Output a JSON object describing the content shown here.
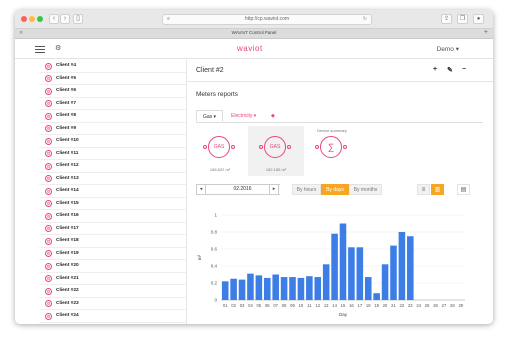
{
  "browser": {
    "url": "http://cp.waviot.com",
    "tab_title": "WAVIoT Control Panel"
  },
  "app": {
    "logo": "waviot",
    "user_menu": "Demo ▾"
  },
  "sidebar": {
    "clients": [
      "Client #4",
      "Client #5",
      "Client #6",
      "Client #7",
      "Client #8",
      "Client #9",
      "Client #10",
      "Client #11",
      "Client #12",
      "Client #13",
      "Client #14",
      "Client #15",
      "Client #16",
      "Client #17",
      "Client #18",
      "Client #19",
      "Client #20",
      "Client #21",
      "Client #22",
      "Client #23",
      "Client #24"
    ]
  },
  "main": {
    "title": "Client #2",
    "section": "Meters reports",
    "resource_tabs": [
      {
        "label": "Gas ▾",
        "active": true
      },
      {
        "label": "Electricity ▾",
        "active": false
      }
    ],
    "meters": [
      {
        "label": "GAS",
        "value": "166,622 m³"
      },
      {
        "label": "GAS",
        "value": "182,185 m³"
      },
      {
        "label": "∑",
        "value": "",
        "header": "Device summary"
      }
    ],
    "date": "02.2016",
    "periods": [
      "By hours",
      "By days",
      "By months"
    ],
    "active_period": "By days"
  },
  "colors": {
    "accent": "#e8467c",
    "bar": "#3d7ee6",
    "active_button": "#f6a623"
  },
  "chart_data": {
    "type": "bar",
    "xlabel": "Day",
    "ylabel": "m³",
    "ylim": [
      0,
      1
    ],
    "yticks": [
      0,
      0.2,
      0.4,
      0.6,
      0.8,
      1
    ],
    "categories": [
      "01",
      "02",
      "03",
      "04",
      "05",
      "06",
      "07",
      "08",
      "09",
      "10",
      "11",
      "12",
      "13",
      "14",
      "15",
      "16",
      "17",
      "18",
      "19",
      "20",
      "21",
      "22",
      "23",
      "24",
      "25",
      "26",
      "27",
      "28",
      "29"
    ],
    "values": [
      0.22,
      0.25,
      0.24,
      0.31,
      0.29,
      0.26,
      0.3,
      0.27,
      0.27,
      0.26,
      0.28,
      0.27,
      0.42,
      0.78,
      0.9,
      0.62,
      0.62,
      0.27,
      0.08,
      0.42,
      0.64,
      0.8,
      0.75,
      0,
      0,
      0,
      0,
      0,
      0
    ]
  }
}
